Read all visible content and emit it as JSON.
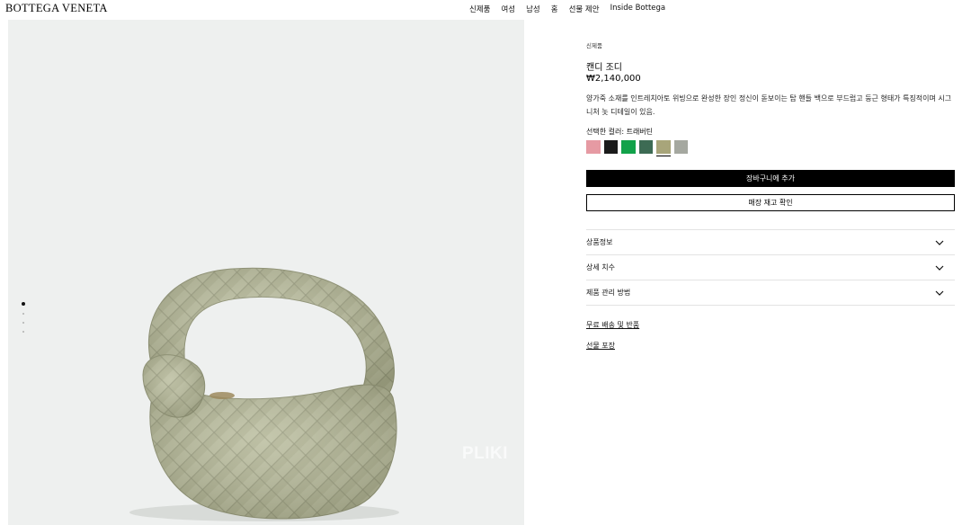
{
  "header": {
    "logo": "BOTTEGA VENETA",
    "nav": [
      "신제품",
      "여성",
      "남성",
      "홈",
      "선물 제안",
      "Inside Bottega"
    ]
  },
  "gallery": {
    "image_alt": "candy jodie bag in travertine intrecciato leather",
    "watermark": "PLIKI",
    "dots_total": 4,
    "active_index": 0
  },
  "product": {
    "category": "신제품",
    "name": "캔디 조디",
    "price": "₩2,140,000",
    "description": "양가죽 소재를 인트레치아토 위빙으로 완성한 장인 정신이 돋보이는 탑 핸들 백으로 부드럽고 둥근 형태가 특징적이며 시그니처 놋 디테일이 있음.",
    "color_label": "선택한 컬러: 트래버틴",
    "swatches": [
      {
        "name": "pink",
        "color": "#e69aa3"
      },
      {
        "name": "black",
        "color": "#1b1b1b"
      },
      {
        "name": "parakeet-green",
        "color": "#12a24a"
      },
      {
        "name": "dark-green",
        "color": "#3d6b54"
      },
      {
        "name": "travertine",
        "color": "#a8a57a",
        "selected": true
      },
      {
        "name": "grey",
        "color": "#a5a8a0"
      }
    ],
    "add_to_cart": "장바구니에 추가",
    "check_stock": "매장 재고 확인",
    "accordion": [
      "상품정보",
      "상세 치수",
      "제품 관리 방법"
    ],
    "links": [
      "무료 배송 및 반품",
      "선물 포장"
    ]
  },
  "colors": {
    "gallery_bg": "#eef0ef",
    "bag_base": "#b9bc9c",
    "accent": "#000000"
  }
}
